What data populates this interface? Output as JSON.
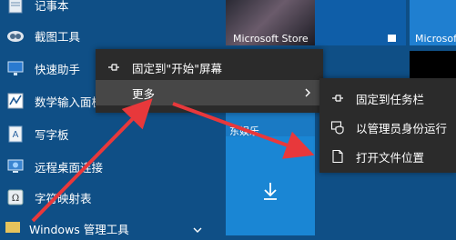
{
  "start_list": [
    {
      "label": "记事本",
      "icon": "notepad-icon"
    },
    {
      "label": "截图工具",
      "icon": "snipping-tool-icon"
    },
    {
      "label": "快速助手",
      "icon": "quick-assist-icon"
    },
    {
      "label": "数学输入面板",
      "icon": "math-input-icon"
    },
    {
      "label": "写字板",
      "icon": "wordpad-icon"
    },
    {
      "label": "远程桌面连接",
      "icon": "remote-desktop-icon"
    },
    {
      "label": "字符映射表",
      "icon": "character-map-icon"
    }
  ],
  "group": {
    "label": "Windows 管理工具",
    "chevron": "chevron-down-icon"
  },
  "tiles": {
    "store_label": "Microsoft Store",
    "tile_right_label": "Microsoft",
    "tile_mid_label": "东娱乐",
    "download_icon": "download-arrow-icon"
  },
  "context_menu": {
    "pin_start": "固定到\"开始\"屏幕",
    "more": "更多"
  },
  "submenu": {
    "pin_taskbar": "固定到任务栏",
    "run_admin": "以管理员身份运行",
    "open_location": "打开文件位置"
  },
  "colors": {
    "start_bg": "#0f4f86",
    "menu_bg": "#2b2b2b",
    "menu_highlight": "#474747",
    "tile_blue": "#1a7ac4",
    "arrow_red": "#e8383b"
  }
}
